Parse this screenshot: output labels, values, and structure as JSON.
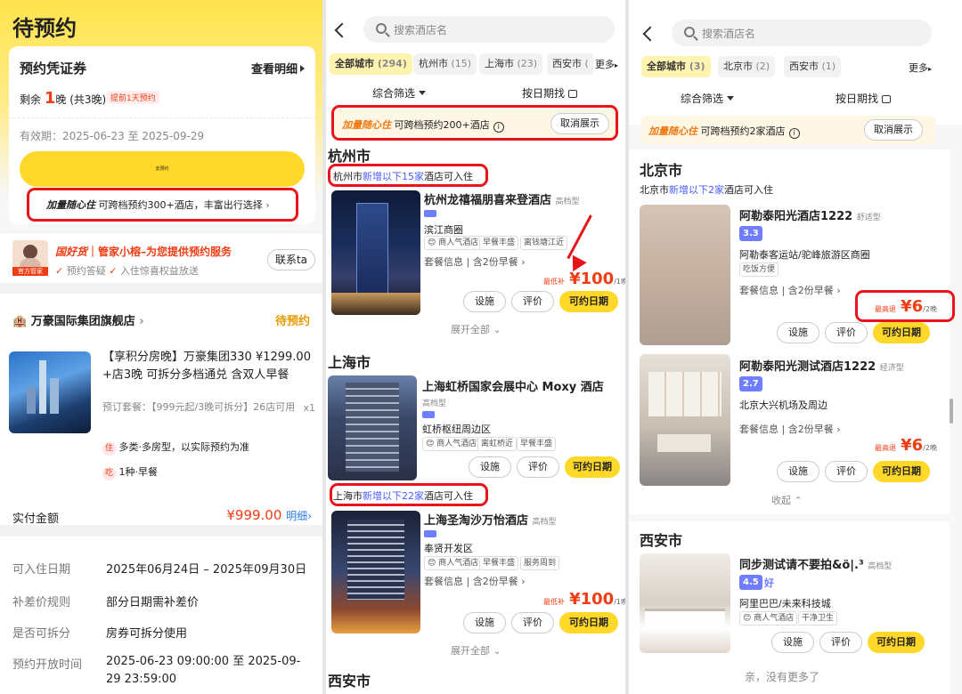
{
  "colors": {
    "accent_yellow": "#ffd829",
    "price_red": "#f03d14",
    "highlight_blue": "#4a5cff",
    "annotation_red": "#e8141c"
  },
  "p1": {
    "title": "待预约",
    "voucher_title": "预约凭证券",
    "voucher_detail": "查看明细",
    "remain_prefix": "剩余",
    "remain_num": "1",
    "remain_unit": "晚",
    "remain_total": "(共3晚)",
    "remain_badge": "提前1天预约",
    "validity": "有效期：2025-06-23 至 2025-09-29",
    "yellow_btn": "去预约",
    "promo_brand": "加量随心住",
    "promo_text": "可跨档预约300+酒店，丰富出行选择",
    "steward_name": "国好货",
    "steward_title": "管家小榕–为您提供预约服务",
    "steward_avatar_label": "官方管家",
    "steward_b1": "预约答疑",
    "steward_b2": "入住惊喜权益放送",
    "steward_btn": "联系ta",
    "store_name": "万豪国际集团旗舰店",
    "store_status": "待预约",
    "product_title": "【享积分房晚】万豪集团330 ¥1299.00 +店3晚 可拆分多档通兑 含双人早餐",
    "product_pkg": "预订套餐：【999元起/3晚可拆分】26店可用",
    "product_qty": "x1",
    "f1_icon": "住",
    "f1": "多类·多房型，以实际预约为准",
    "f2_icon": "吃",
    "f2": "1种·早餐",
    "pay_label": "实付金额",
    "pay_value": "¥999.00",
    "pay_detail": "明细",
    "rows": [
      {
        "k": "可入住日期",
        "v": "2025年06月24日 – 2025年09月30日"
      },
      {
        "k": "补差价规则",
        "v": "部分日期需补差价"
      },
      {
        "k": "是否可拆分",
        "v": "房券可拆分使用"
      },
      {
        "k": "预约开放时间",
        "v": "2025-06-23 09:00:00 至 2025-09-29 23:59:00"
      }
    ]
  },
  "p2": {
    "search_placeholder": "搜索酒店名",
    "tabs": [
      {
        "label": "全部城市",
        "count": "(294)"
      },
      {
        "label": "杭州市",
        "count": "(15)"
      },
      {
        "label": "上海市",
        "count": "(23)"
      },
      {
        "label": "西安市",
        "count": "("
      }
    ],
    "more": "更多",
    "filter": "综合筛选",
    "date": "按日期找",
    "banner_brand": "加量随心住",
    "banner_text": "可跨档预约200+酒店",
    "banner_btn": "取消展示",
    "city1": "杭州市",
    "city1_note_a": "杭州市",
    "city1_note_b": "新增以下15家",
    "city1_note_c": "酒店可入住",
    "h1": {
      "name": "杭州龙禧福朋喜来登酒店",
      "grade": "高档型",
      "area": "滨江商圈",
      "tags": [
        "商人气酒店",
        "早餐丰盛",
        "离钱塘江近"
      ],
      "pkg": "套餐信息 | 含2份早餐",
      "price_label": "最低补",
      "price": "¥100",
      "price_unit": "/1晚"
    },
    "expand": "展开全部",
    "city2": "上海市",
    "h2": {
      "name": "上海虹桥国家会展中心 Moxy 酒店",
      "grade": "高档型",
      "area": "虹桥枢纽周边区",
      "tags": [
        "商人气酒店",
        "离虹桥近",
        "早餐丰盛"
      ]
    },
    "city2_note_a": "上海市",
    "city2_note_b": "新增以下22家",
    "city2_note_c": "酒店可入住",
    "h3": {
      "name": "上海圣淘沙万怡酒店",
      "grade": "高档型",
      "area": "奉贤开发区",
      "tags": [
        "商人气酒店",
        "早餐丰盛",
        "服务周到"
      ],
      "pkg": "套餐信息 | 含2份早餐",
      "price_label": "最低补",
      "price": "¥100",
      "price_unit": "/1晚"
    },
    "btn_fac": "设施",
    "btn_rev": "评价",
    "btn_book": "可约日期",
    "city3": "西安市"
  },
  "p3": {
    "search_placeholder": "搜索酒店名",
    "tabs": [
      {
        "label": "全部城市",
        "count": "(3)"
      },
      {
        "label": "北京市",
        "count": "(2)"
      },
      {
        "label": "西安市",
        "count": "(1)"
      }
    ],
    "more": "更多",
    "filter": "综合筛选",
    "date": "按日期找",
    "banner_brand": "加量随心住",
    "banner_text": "可跨档预约2家酒店",
    "banner_btn": "取消展示",
    "city1": "北京市",
    "city1_note_a": "北京市",
    "city1_note_b": "新增以下2家",
    "city1_note_c": "酒店可入住",
    "h1": {
      "name": "阿勒泰阳光酒店1222",
      "grade": "舒适型",
      "score": "3.3",
      "area": "阿勒泰客运站/驼峰旅游区商圈",
      "tag": "吃饭方便",
      "pkg": "套餐信息 | 含2份早餐",
      "price_label": "最高退",
      "price": "¥6",
      "price_unit": "/2晚"
    },
    "h2": {
      "name": "阿勒泰阳光测试酒店1222",
      "grade": "经济型",
      "score": "2.7",
      "area": "北京大兴机场及周边",
      "pkg": "套餐信息 | 含2份早餐",
      "price_label": "最高退",
      "price": "¥6",
      "price_unit": "/2晚"
    },
    "collapse": "收起",
    "city2": "西安市",
    "h3": {
      "name": "同步测试请不要拍&ö|.³",
      "grade": "高档型",
      "score": "4.5",
      "score_word": "好",
      "area": "阿里巴巴/未来科技城",
      "tags": [
        "商人气酒店",
        "干净卫生"
      ]
    },
    "btn_fac": "设施",
    "btn_rev": "评价",
    "btn_book": "可约日期",
    "end": "亲，没有更多了"
  }
}
